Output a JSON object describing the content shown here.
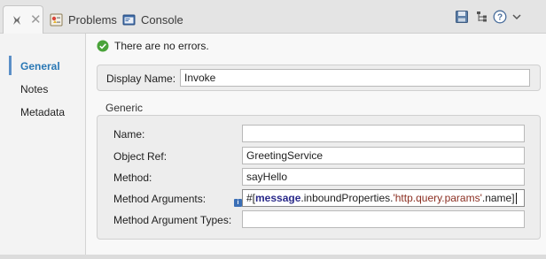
{
  "tabs": {
    "problems_label": "Problems",
    "console_label": "Console"
  },
  "toolbar": {
    "icons": [
      "save-icon",
      "tree-icon",
      "help-icon",
      "chevron-down-icon"
    ]
  },
  "sidebar": {
    "items": [
      {
        "label": "General",
        "active": true
      },
      {
        "label": "Notes",
        "active": false
      },
      {
        "label": "Metadata",
        "active": false
      }
    ]
  },
  "status": {
    "text": "There are no errors."
  },
  "display": {
    "label": "Display Name:",
    "value": "Invoke"
  },
  "generic": {
    "title": "Generic",
    "name_label": "Name:",
    "name_value": "",
    "object_ref_label": "Object Ref:",
    "object_ref_value": "GreetingService",
    "method_label": "Method:",
    "method_value": "sayHello",
    "method_args_label": "Method Arguments:",
    "method_args_parts": {
      "prefix": "#[",
      "keyword": "message",
      "middle": ".inboundProperties.",
      "string": "'http.query.params'",
      "suffix": ".name]"
    },
    "method_arg_types_label": "Method Argument Types:",
    "method_arg_types_value": ""
  },
  "colors": {
    "accent": "#2a78b5",
    "ok_green": "#4aa33a",
    "keyword": "#2a2a8a",
    "string": "#8b2f22"
  }
}
